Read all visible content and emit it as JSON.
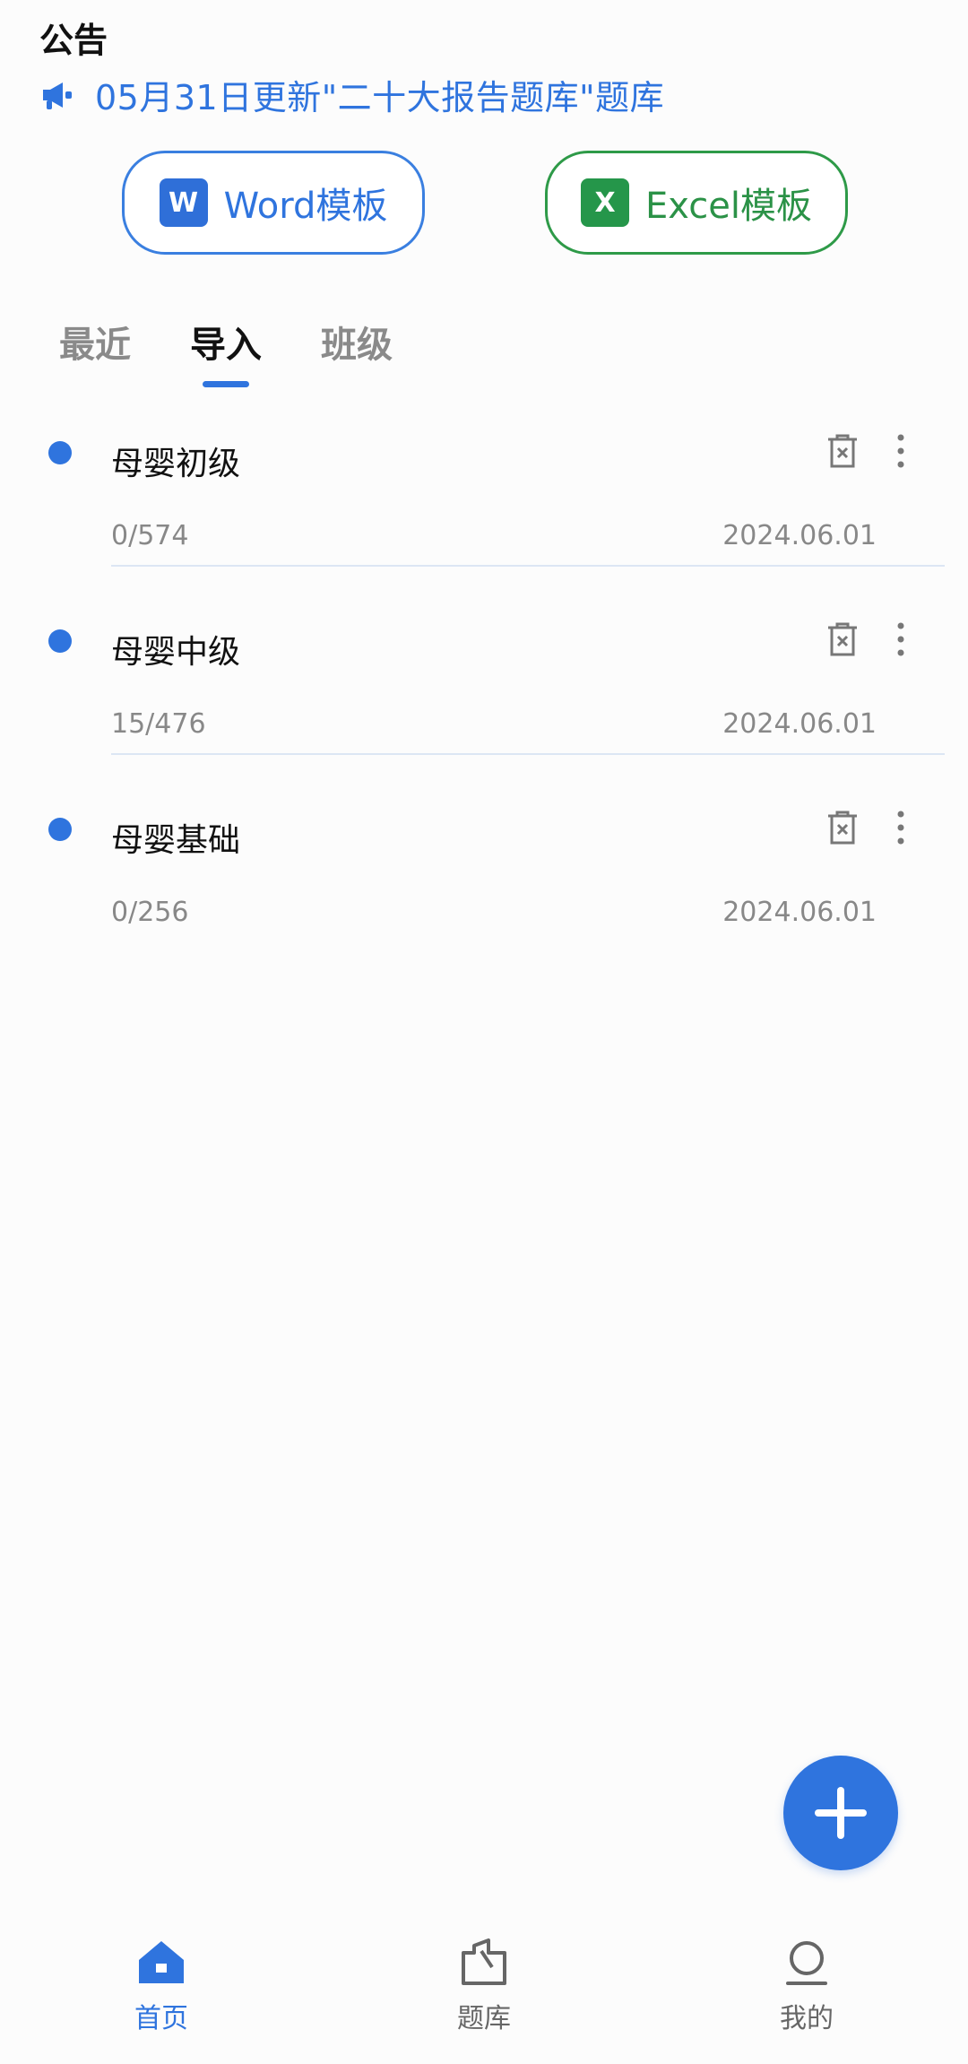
{
  "announcement": {
    "title": "公告",
    "text": "05月31日更新\"二十大报告题库\"题库",
    "icon": "megaphone-icon"
  },
  "templates": {
    "word": {
      "label": "Word模板",
      "icon": "word-icon",
      "icon_letter": "W",
      "color": "#2f74de"
    },
    "excel": {
      "label": "Excel模板",
      "icon": "excel-icon",
      "icon_letter": "X",
      "color": "#2b9247"
    }
  },
  "tabs": [
    {
      "label": "最近",
      "active": false
    },
    {
      "label": "导入",
      "active": true
    },
    {
      "label": "班级",
      "active": false
    }
  ],
  "items": [
    {
      "name": "母婴初级",
      "progress": "0/574",
      "date": "2024.06.01"
    },
    {
      "name": "母婴中级",
      "progress": "15/476",
      "date": "2024.06.01"
    },
    {
      "name": "母婴基础",
      "progress": "0/256",
      "date": "2024.06.01"
    }
  ],
  "nav": [
    {
      "label": "首页",
      "icon": "home-icon",
      "active": true
    },
    {
      "label": "题库",
      "icon": "question-bank-icon",
      "active": false
    },
    {
      "label": "我的",
      "icon": "profile-icon",
      "active": false
    }
  ],
  "colors": {
    "accent": "#2f74de",
    "excel_green": "#2e9a48"
  }
}
